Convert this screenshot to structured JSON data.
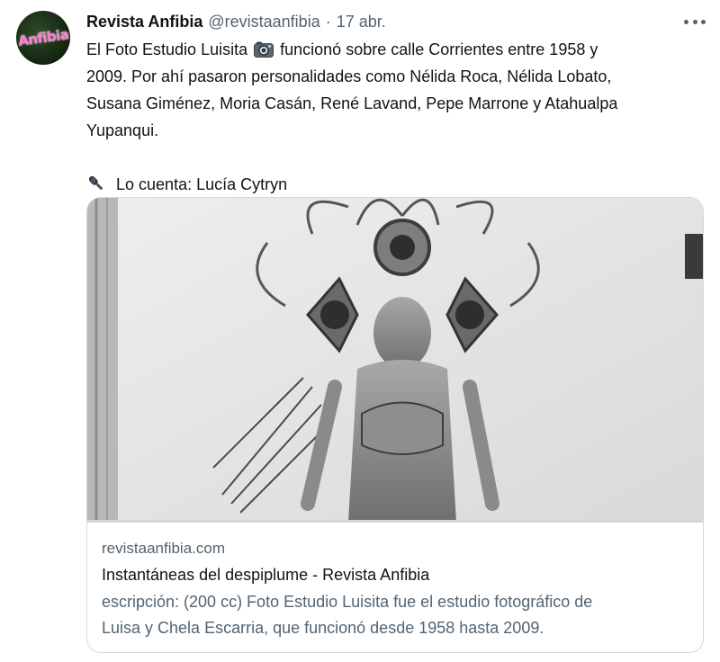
{
  "tweet": {
    "avatar_label": "Anfibia",
    "display_name": "Revista Anfibia",
    "handle": "@revistaanfibia",
    "separator": "·",
    "date": "17 abr.",
    "text_lines": {
      "l1_before": "El Foto Estudio Luisita",
      "l1_after": "funcionó sobre calle Corrientes entre 1958 y",
      "l2": "2009. Por ahí pasaron personalidades como Nélida Roca, Nélida Lobato,",
      "l3": "Susana Giménez, Moria Casán, René Lavand, Pepe Marrone y Atahualpa",
      "l4": "Yupanqui.",
      "l6": "Lo cuenta: Lucía Cytryn"
    },
    "icons": {
      "camera": "camera-icon",
      "microphone": "microphone-icon",
      "more": "more-icon"
    }
  },
  "card": {
    "domain": "revistaanfibia.com",
    "title": "Instantáneas del despiplume - Revista Anfibia",
    "description_line1": "escripción: (200 cc) Foto Estudio Luisita fue el estudio fotográfico de",
    "description_line2": "Luisa y Chela Escarria, que funcionó desde 1958 hasta 2009."
  },
  "colors": {
    "text": "#0f1419",
    "secondary": "#536471",
    "border": "#cfd9de",
    "avatar_text": "#ff7ad1"
  }
}
